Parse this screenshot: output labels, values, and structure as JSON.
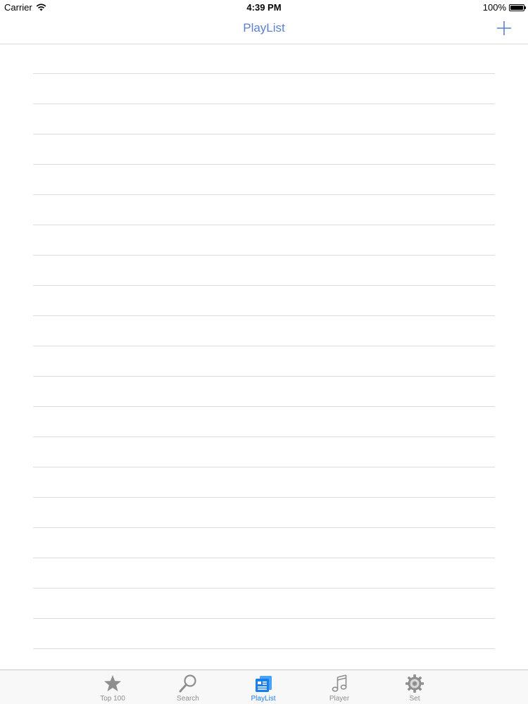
{
  "status_bar": {
    "carrier": "Carrier",
    "time": "4:39 PM",
    "battery": "100%",
    "wifi_icon": "wifi-icon",
    "battery_icon": "battery-icon"
  },
  "nav": {
    "title": "PlayList",
    "add_icon": "plus-icon"
  },
  "list": {
    "row_count": 20
  },
  "tabs": [
    {
      "label": "Top 100",
      "icon": "star-icon",
      "active": false
    },
    {
      "label": "Search",
      "icon": "magnifier-icon",
      "active": false
    },
    {
      "label": "PlayList",
      "icon": "playlist-icon",
      "active": true
    },
    {
      "label": "Player",
      "icon": "music-note-icon",
      "active": false
    },
    {
      "label": "Set",
      "icon": "gear-icon",
      "active": false
    }
  ],
  "colors": {
    "accent": "#5b7fd0",
    "tab_active": "#1a7ef0",
    "tab_inactive": "#8e8e8e",
    "separator": "#dcdcdc"
  }
}
